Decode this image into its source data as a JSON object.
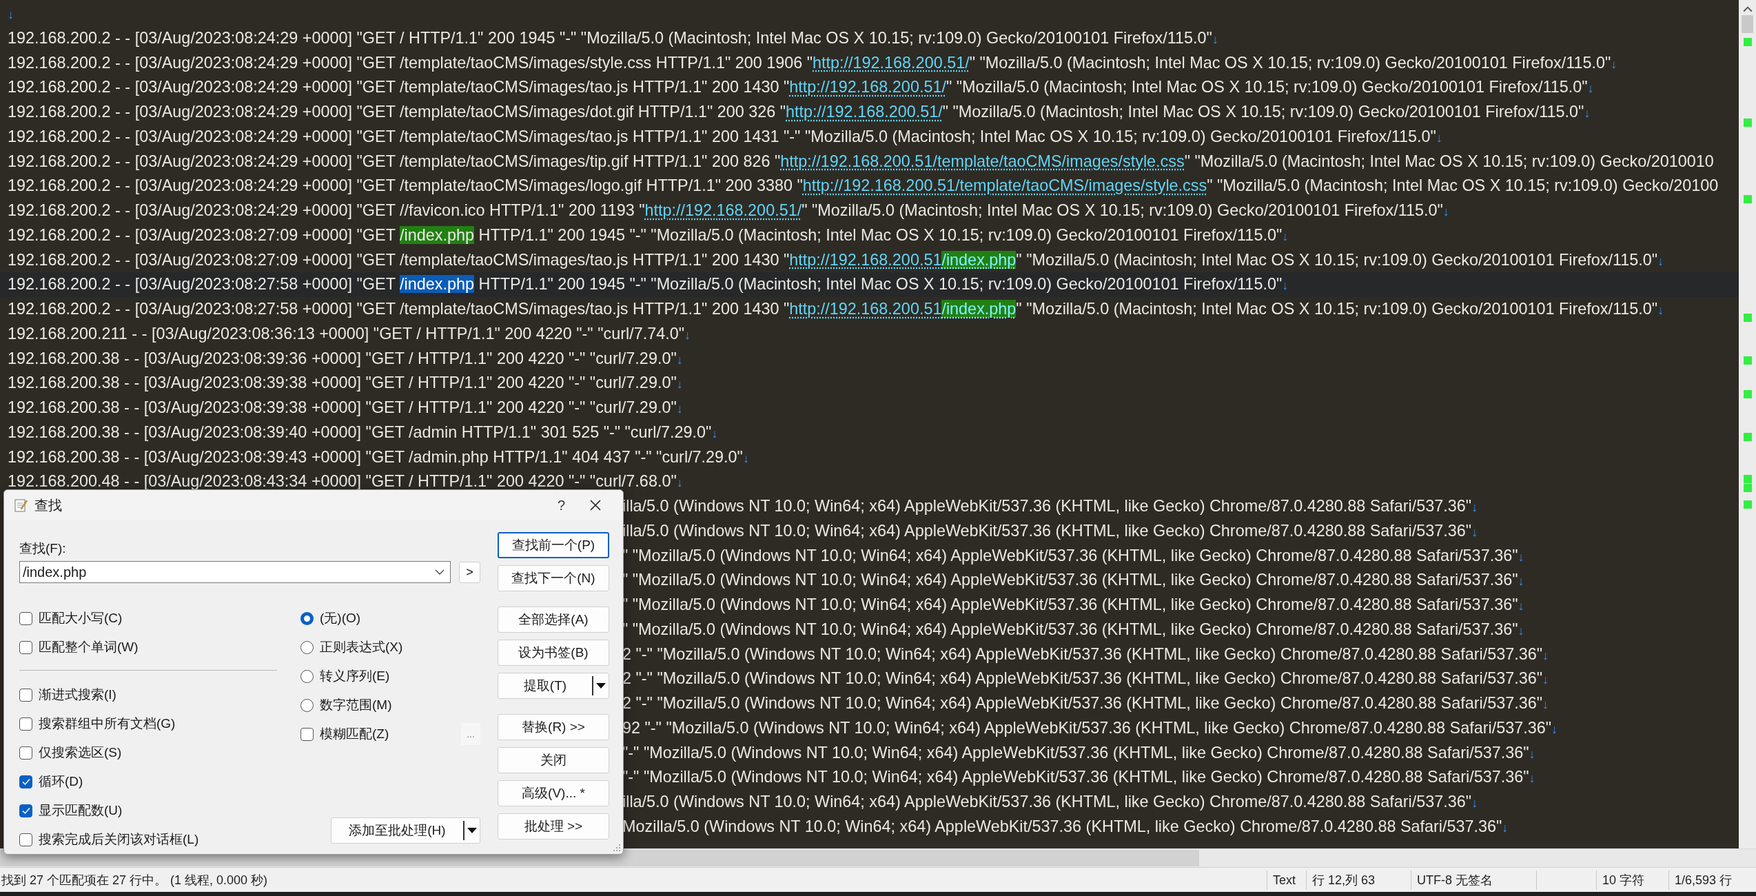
{
  "editor": {
    "lines": [
      {
        "current": false,
        "segments": [
          {
            "kind": "eol",
            "text": "↓"
          }
        ]
      },
      {
        "current": false,
        "segments": [
          {
            "kind": "plain",
            "text": "192.168.200.2 - - [03/Aug/2023:08:24:29 +0000] \"GET / HTTP/1.1\" 200 1945 \"-\" \"Mozilla/5.0 (Macintosh; Intel Mac OS X 10.15; rv:109.0) Gecko/20100101 Firefox/115.0\""
          },
          {
            "kind": "eol",
            "text": "↓"
          }
        ]
      },
      {
        "current": false,
        "segments": [
          {
            "kind": "plain",
            "text": "192.168.200.2 - - [03/Aug/2023:08:24:29 +0000] \"GET /template/taoCMS/images/style.css HTTP/1.1\" 200 1906 \""
          },
          {
            "kind": "link",
            "text": "http://192.168.200.51/"
          },
          {
            "kind": "plain",
            "text": "\" \"Mozilla/5.0 (Macintosh; Intel Mac OS X 10.15; rv:109.0) Gecko/20100101 Firefox/115.0\""
          },
          {
            "kind": "eol",
            "text": "↓"
          }
        ]
      },
      {
        "current": false,
        "segments": [
          {
            "kind": "plain",
            "text": "192.168.200.2 - - [03/Aug/2023:08:24:29 +0000] \"GET /template/taoCMS/images/tao.js HTTP/1.1\" 200 1430 \""
          },
          {
            "kind": "link",
            "text": "http://192.168.200.51/"
          },
          {
            "kind": "plain",
            "text": "\" \"Mozilla/5.0 (Macintosh; Intel Mac OS X 10.15; rv:109.0) Gecko/20100101 Firefox/115.0\""
          },
          {
            "kind": "eol",
            "text": "↓"
          }
        ]
      },
      {
        "current": false,
        "segments": [
          {
            "kind": "plain",
            "text": "192.168.200.2 - - [03/Aug/2023:08:24:29 +0000] \"GET /template/taoCMS/images/dot.gif HTTP/1.1\" 200 326 \""
          },
          {
            "kind": "link",
            "text": "http://192.168.200.51/"
          },
          {
            "kind": "plain",
            "text": "\" \"Mozilla/5.0 (Macintosh; Intel Mac OS X 10.15; rv:109.0) Gecko/20100101 Firefox/115.0\""
          },
          {
            "kind": "eol",
            "text": "↓"
          }
        ]
      },
      {
        "current": false,
        "segments": [
          {
            "kind": "plain",
            "text": "192.168.200.2 - - [03/Aug/2023:08:24:29 +0000] \"GET /template/taoCMS/images/tao.js HTTP/1.1\" 200 1431 \"-\" \"Mozilla/5.0 (Macintosh; Intel Mac OS X 10.15; rv:109.0) Gecko/20100101 Firefox/115.0\""
          },
          {
            "kind": "eol",
            "text": "↓"
          }
        ]
      },
      {
        "current": false,
        "segments": [
          {
            "kind": "plain",
            "text": "192.168.200.2 - - [03/Aug/2023:08:24:29 +0000] \"GET /template/taoCMS/images/tip.gif HTTP/1.1\" 200 826 \""
          },
          {
            "kind": "link",
            "text": "http://192.168.200.51/template/taoCMS/images/style.css"
          },
          {
            "kind": "plain",
            "text": "\" \"Mozilla/5.0 (Macintosh; Intel Mac OS X 10.15; rv:109.0) Gecko/2010010"
          }
        ]
      },
      {
        "current": false,
        "segments": [
          {
            "kind": "plain",
            "text": "192.168.200.2 - - [03/Aug/2023:08:24:29 +0000] \"GET /template/taoCMS/images/logo.gif HTTP/1.1\" 200 3380 \""
          },
          {
            "kind": "link",
            "text": "http://192.168.200.51/template/taoCMS/images/style.css"
          },
          {
            "kind": "plain",
            "text": "\" \"Mozilla/5.0 (Macintosh; Intel Mac OS X 10.15; rv:109.0) Gecko/20100"
          }
        ]
      },
      {
        "current": false,
        "segments": [
          {
            "kind": "plain",
            "text": "192.168.200.2 - - [03/Aug/2023:08:24:29 +0000] \"GET //favicon.ico HTTP/1.1\" 200 1193 \""
          },
          {
            "kind": "link",
            "text": "http://192.168.200.51/"
          },
          {
            "kind": "plain",
            "text": "\" \"Mozilla/5.0 (Macintosh; Intel Mac OS X 10.15; rv:109.0) Gecko/20100101 Firefox/115.0\""
          },
          {
            "kind": "eol",
            "text": "↓"
          }
        ]
      },
      {
        "current": false,
        "segments": [
          {
            "kind": "plain",
            "text": "192.168.200.2 - - [03/Aug/2023:08:27:09 +0000] \"GET "
          },
          {
            "kind": "match",
            "text": "/index.php"
          },
          {
            "kind": "plain",
            "text": " HTTP/1.1\" 200 1945 \"-\" \"Mozilla/5.0 (Macintosh; Intel Mac OS X 10.15; rv:109.0) Gecko/20100101 Firefox/115.0\""
          },
          {
            "kind": "eol",
            "text": "↓"
          }
        ]
      },
      {
        "current": false,
        "segments": [
          {
            "kind": "plain",
            "text": "192.168.200.2 - - [03/Aug/2023:08:27:09 +0000] \"GET /template/taoCMS/images/tao.js HTTP/1.1\" 200 1430 \""
          },
          {
            "kind": "link",
            "text": "http://192.168.200.51"
          },
          {
            "kind": "link_match",
            "text": "/index.php"
          },
          {
            "kind": "plain",
            "text": "\" \"Mozilla/5.0 (Macintosh; Intel Mac OS X 10.15; rv:109.0) Gecko/20100101 Firefox/115.0\""
          },
          {
            "kind": "eol",
            "text": "↓"
          }
        ]
      },
      {
        "current": true,
        "segments": [
          {
            "kind": "plain",
            "text": "192.168.200.2 - - [03/Aug/2023:08:27:58 +0000] \"GET "
          },
          {
            "kind": "selection",
            "text": "/index.php"
          },
          {
            "kind": "plain",
            "text": " HTTP/1.1\" 200 1945 \"-\" \"Mozilla/5.0 (Macintosh; Intel Mac OS X 10.15; rv:109.0) Gecko/20100101 Firefox/115.0\""
          },
          {
            "kind": "eol",
            "text": "↓"
          }
        ]
      },
      {
        "current": false,
        "segments": [
          {
            "kind": "plain",
            "text": "192.168.200.2 - - [03/Aug/2023:08:27:58 +0000] \"GET /template/taoCMS/images/tao.js HTTP/1.1\" 200 1430 \""
          },
          {
            "kind": "link",
            "text": "http://192.168.200.51"
          },
          {
            "kind": "link_match",
            "text": "/index.php"
          },
          {
            "kind": "plain",
            "text": "\" \"Mozilla/5.0 (Macintosh; Intel Mac OS X 10.15; rv:109.0) Gecko/20100101 Firefox/115.0\""
          },
          {
            "kind": "eol",
            "text": "↓"
          }
        ]
      },
      {
        "current": false,
        "segments": [
          {
            "kind": "plain",
            "text": "192.168.200.211 - - [03/Aug/2023:08:36:13 +0000] \"GET / HTTP/1.1\" 200 4220 \"-\" \"curl/7.74.0\""
          },
          {
            "kind": "eol",
            "text": "↓"
          }
        ]
      },
      {
        "current": false,
        "segments": [
          {
            "kind": "plain",
            "text": "192.168.200.38 - - [03/Aug/2023:08:39:36 +0000] \"GET / HTTP/1.1\" 200 4220 \"-\" \"curl/7.29.0\""
          },
          {
            "kind": "eol",
            "text": "↓"
          }
        ]
      },
      {
        "current": false,
        "segments": [
          {
            "kind": "plain",
            "text": "192.168.200.38 - - [03/Aug/2023:08:39:38 +0000] \"GET / HTTP/1.1\" 200 4220 \"-\" \"curl/7.29.0\""
          },
          {
            "kind": "eol",
            "text": "↓"
          }
        ]
      },
      {
        "current": false,
        "segments": [
          {
            "kind": "plain",
            "text": "192.168.200.38 - - [03/Aug/2023:08:39:38 +0000] \"GET / HTTP/1.1\" 200 4220 \"-\" \"curl/7.29.0\""
          },
          {
            "kind": "eol",
            "text": "↓"
          }
        ]
      },
      {
        "current": false,
        "segments": [
          {
            "kind": "plain",
            "text": "192.168.200.38 - - [03/Aug/2023:08:39:40 +0000] \"GET /admin HTTP/1.1\" 301 525 \"-\" \"curl/7.29.0\""
          },
          {
            "kind": "eol",
            "text": "↓"
          }
        ]
      },
      {
        "current": false,
        "segments": [
          {
            "kind": "plain",
            "text": "192.168.200.38 - - [03/Aug/2023:08:39:43 +0000] \"GET /admin.php HTTP/1.1\" 404 437 \"-\" \"curl/7.29.0\""
          },
          {
            "kind": "eol",
            "text": "↓"
          }
        ]
      },
      {
        "current": false,
        "segments": [
          {
            "kind": "plain",
            "text": "192.168.200.48 - - [03/Aug/2023:08:43:34 +0000] \"GET / HTTP/1.1\" 200 4220 \"-\" \"curl/7.68.0\""
          },
          {
            "kind": "eol",
            "text": "↓"
          }
        ]
      }
    ],
    "lines_beside_dialog": [
      {
        "segments": [
          {
            "kind": "plain",
            "text": "illa/5.0 (Windows NT 10.0; Win64; x64) AppleWebKit/537.36 (KHTML, like Gecko) Chrome/87.0.4280.88 Safari/537.36\""
          },
          {
            "kind": "eol",
            "text": "↓"
          }
        ]
      },
      {
        "segments": [
          {
            "kind": "plain",
            "text": "illa/5.0 (Windows NT 10.0; Win64; x64) AppleWebKit/537.36 (KHTML, like Gecko) Chrome/87.0.4280.88 Safari/537.36\""
          },
          {
            "kind": "eol",
            "text": "↓"
          }
        ]
      },
      {
        "segments": [
          {
            "kind": "plain",
            "text": "\" \"Mozilla/5.0 (Windows NT 10.0; Win64; x64) AppleWebKit/537.36 (KHTML, like Gecko) Chrome/87.0.4280.88 Safari/537.36\""
          },
          {
            "kind": "eol",
            "text": "↓"
          }
        ]
      },
      {
        "segments": [
          {
            "kind": "plain",
            "text": "\" \"Mozilla/5.0 (Windows NT 10.0; Win64; x64) AppleWebKit/537.36 (KHTML, like Gecko) Chrome/87.0.4280.88 Safari/537.36\""
          },
          {
            "kind": "eol",
            "text": "↓"
          }
        ]
      },
      {
        "segments": [
          {
            "kind": "plain",
            "text": "\" \"Mozilla/5.0 (Windows NT 10.0; Win64; x64) AppleWebKit/537.36 (KHTML, like Gecko) Chrome/87.0.4280.88 Safari/537.36\""
          },
          {
            "kind": "eol",
            "text": "↓"
          }
        ]
      },
      {
        "segments": [
          {
            "kind": "plain",
            "text": "\" \"Mozilla/5.0 (Windows NT 10.0; Win64; x64) AppleWebKit/537.36 (KHTML, like Gecko) Chrome/87.0.4280.88 Safari/537.36\""
          },
          {
            "kind": "eol",
            "text": "↓"
          }
        ]
      },
      {
        "segments": [
          {
            "kind": "plain",
            "text": "2 \"-\" \"Mozilla/5.0 (Windows NT 10.0; Win64; x64) AppleWebKit/537.36 (KHTML, like Gecko) Chrome/87.0.4280.88 Safari/537.36\""
          },
          {
            "kind": "eol",
            "text": "↓"
          }
        ]
      },
      {
        "segments": [
          {
            "kind": "plain",
            "text": "2 \"-\" \"Mozilla/5.0 (Windows NT 10.0; Win64; x64) AppleWebKit/537.36 (KHTML, like Gecko) Chrome/87.0.4280.88 Safari/537.36\""
          },
          {
            "kind": "eol",
            "text": "↓"
          }
        ]
      },
      {
        "segments": [
          {
            "kind": "plain",
            "text": "2 \"-\" \"Mozilla/5.0 (Windows NT 10.0; Win64; x64) AppleWebKit/537.36 (KHTML, like Gecko) Chrome/87.0.4280.88 Safari/537.36\""
          },
          {
            "kind": "eol",
            "text": "↓"
          }
        ]
      },
      {
        "segments": [
          {
            "kind": "plain",
            "text": "92 \"-\" \"Mozilla/5.0 (Windows NT 10.0; Win64; x64) AppleWebKit/537.36 (KHTML, like Gecko) Chrome/87.0.4280.88 Safari/537.36\""
          },
          {
            "kind": "eol",
            "text": "↓"
          }
        ]
      },
      {
        "segments": [
          {
            "kind": "plain",
            "text": "\"-\" \"Mozilla/5.0 (Windows NT 10.0; Win64; x64) AppleWebKit/537.36 (KHTML, like Gecko) Chrome/87.0.4280.88 Safari/537.36\""
          },
          {
            "kind": "eol",
            "text": "↓"
          }
        ]
      },
      {
        "segments": [
          {
            "kind": "plain",
            "text": "\"-\" \"Mozilla/5.0 (Windows NT 10.0; Win64; x64) AppleWebKit/537.36 (KHTML, like Gecko) Chrome/87.0.4280.88 Safari/537.36\""
          },
          {
            "kind": "eol",
            "text": "↓"
          }
        ]
      },
      {
        "segments": [
          {
            "kind": "plain",
            "text": "illa/5.0 (Windows NT 10.0; Win64; x64) AppleWebKit/537.36 (KHTML, like Gecko) Chrome/87.0.4280.88 Safari/537.36\""
          },
          {
            "kind": "eol",
            "text": "↓"
          }
        ]
      },
      {
        "segments": [
          {
            "kind": "plain",
            "text": "Mozilla/5.0 (Windows NT 10.0; Win64; x64) AppleWebKit/537.36 (KHTML, like Gecko) Chrome/87.0.4280.88 Safari/537.36\""
          },
          {
            "kind": "eol",
            "text": "↓"
          }
        ]
      }
    ]
  },
  "find_dialog": {
    "title": "查找",
    "help": "?",
    "find_label": "查找(F):",
    "find_field": {
      "value": "/index.php"
    },
    "history_button": ">",
    "match_options": [
      {
        "label": "匹配大小写(C)",
        "checked": false
      },
      {
        "label": "匹配整个单词(W)",
        "checked": false
      }
    ],
    "search_options": [
      {
        "label": "渐进式搜索(I)",
        "checked": false
      },
      {
        "label": "搜索群组中所有文档(G)",
        "checked": false
      },
      {
        "label": "仅搜索选区(S)",
        "checked": false
      },
      {
        "label": "循环(D)",
        "checked": true
      },
      {
        "label": "显示匹配数(U)",
        "checked": true
      },
      {
        "label": "搜索完成后关闭该对话框(L)",
        "checked": false
      }
    ],
    "modes": [
      {
        "label": "(无)(O)",
        "selected": true
      },
      {
        "label": "正则表达式(X)",
        "selected": false
      },
      {
        "label": "转义序列(E)",
        "selected": false
      },
      {
        "label": "数字范围(M)",
        "selected": false
      }
    ],
    "fuzzy": {
      "label": "模糊匹配(Z)",
      "checked": false
    },
    "fuzzy_settings_button": "...",
    "button_groups": [
      [
        {
          "label": "查找前一个(P)",
          "kind": "default"
        },
        {
          "label": "查找下一个(N)",
          "kind": "normal"
        }
      ],
      [
        {
          "label": "全部选择(A)",
          "kind": "normal"
        },
        {
          "label": "设为书签(B)",
          "kind": "normal"
        },
        {
          "label": "提取(T)",
          "kind": "split"
        }
      ],
      [
        {
          "label": "替换(R) >>",
          "kind": "normal"
        },
        {
          "label": "关闭",
          "kind": "normal"
        },
        {
          "label": "高级(V)... *",
          "kind": "normal"
        },
        {
          "label": "批处理 >>",
          "kind": "normal"
        }
      ]
    ],
    "batch_add_button": {
      "label": "添加至批处理(H)",
      "kind": "split"
    }
  },
  "status_bar": {
    "message": "找到 27 个匹配项在 27 行中。 (1 线程, 0.000 秒)",
    "mode": "Text",
    "position": "行 12,列 63",
    "encoding": "UTF-8 无签名",
    "selection": "10 字符",
    "line_count": "1/6,593 行"
  }
}
